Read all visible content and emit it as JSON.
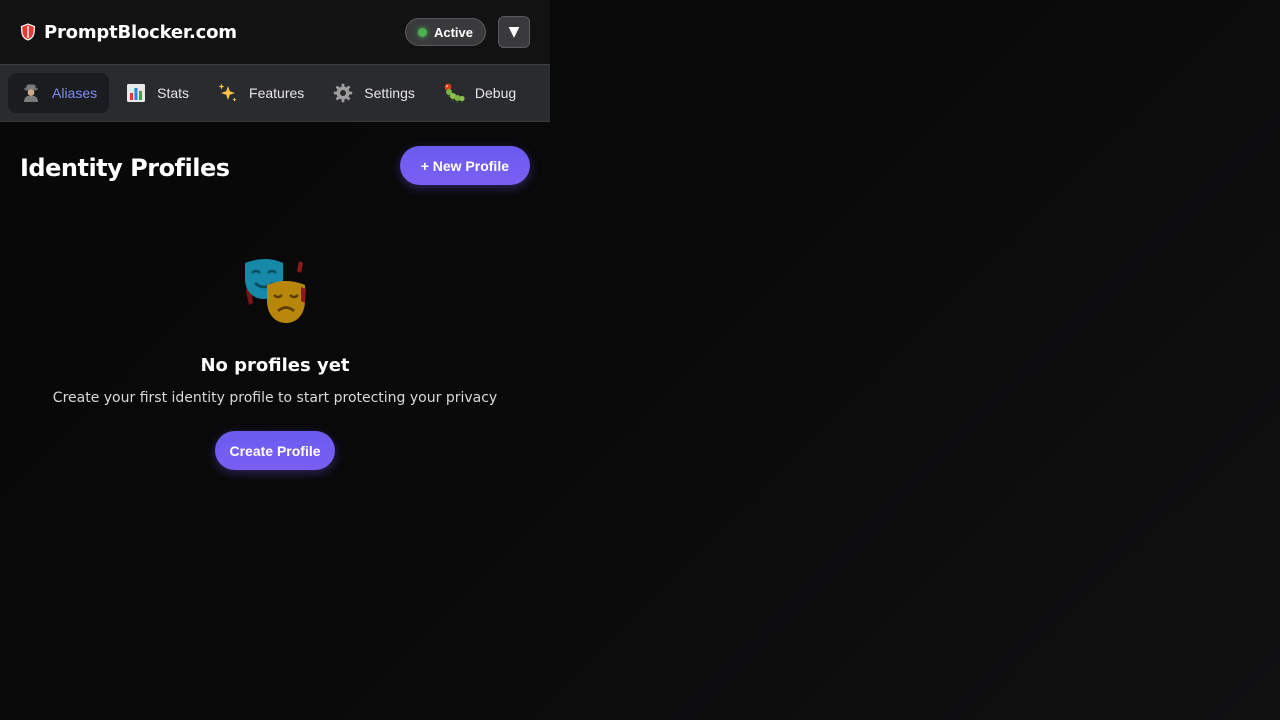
{
  "header": {
    "brand_name": "PromptBlocker.com",
    "status_label": "Active",
    "dropdown_glyph": "▼"
  },
  "tabs": [
    {
      "label": "Aliases",
      "icon": "detective-icon",
      "active": true
    },
    {
      "label": "Stats",
      "icon": "bar-chart-icon",
      "active": false
    },
    {
      "label": "Features",
      "icon": "sparkles-icon",
      "active": false
    },
    {
      "label": "Settings",
      "icon": "gear-icon",
      "active": false
    },
    {
      "label": "Debug",
      "icon": "bug-icon",
      "active": false
    }
  ],
  "main": {
    "title": "Identity Profiles",
    "new_profile_label": "+ New Profile",
    "empty_state": {
      "icon": "theater-masks-icon",
      "title": "No profiles yet",
      "description": "Create your first identity profile to start protecting your privacy",
      "cta_label": "Create Profile"
    }
  },
  "colors": {
    "accent": "#6a5cf0",
    "active_tab_text": "#7c8cf6",
    "status_dot": "#4caf50",
    "background": "#0b0b0c"
  }
}
